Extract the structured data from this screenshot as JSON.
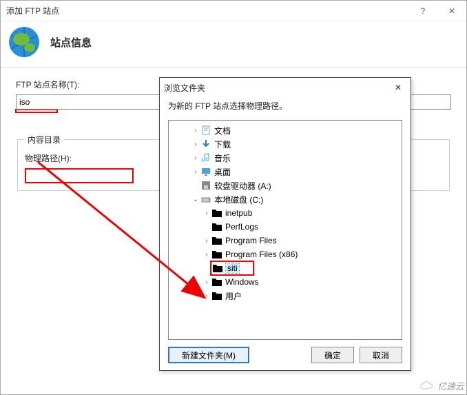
{
  "main": {
    "title": "添加 FTP 站点",
    "heading": "站点信息",
    "site_name_label": "FTP 站点名称(T):",
    "site_name_value": "iso",
    "content_dir_legend": "内容目录",
    "physical_path_label": "物理路径(H):",
    "physical_path_value": ""
  },
  "dialog": {
    "title": "浏览文件夹",
    "subtitle": "为新的 FTP 站点选择物理路径。",
    "new_folder_btn": "新建文件夹(M)",
    "ok_btn": "确定",
    "cancel_btn": "取消"
  },
  "tree": {
    "n0": "文档",
    "n1": "下载",
    "n2": "音乐",
    "n3": "桌面",
    "n4": "软盘驱动器 (A:)",
    "n5": "本地磁盘 (C:)",
    "n5_0": "inetpub",
    "n5_1": "PerfLogs",
    "n5_2": "Program Files",
    "n5_3": "Program Files (x86)",
    "n5_4": "siti",
    "n5_5": "Windows",
    "n5_6": "用户"
  },
  "watermark": "亿速云"
}
